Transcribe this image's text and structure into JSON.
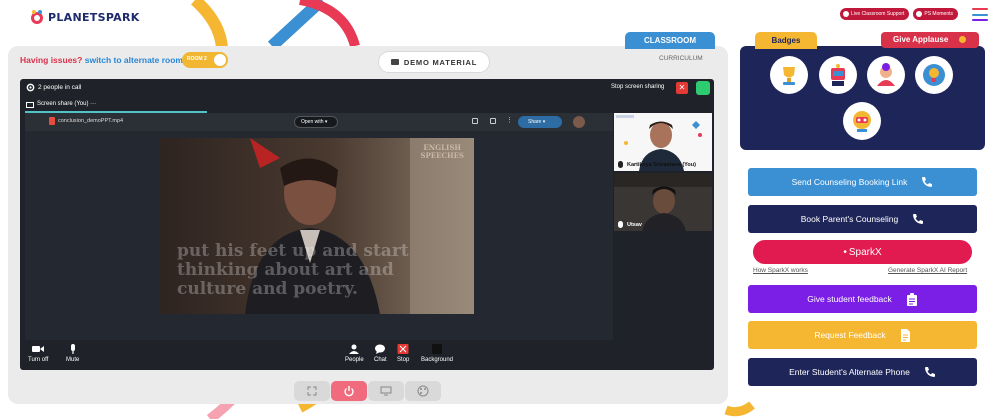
{
  "header": {
    "logo_text": "PLANETSPARK",
    "pills": [
      "Live Classroom Support",
      "PS Moments"
    ]
  },
  "left_panel": {
    "issues_text": "Having issues?",
    "switch_text": "switch to alternate room",
    "room_toggle": "ROOM 2",
    "demo_material": "DEMO MATERIAL",
    "classroom_tab": "CLASSROOM",
    "curriculum": "CURRICULUM"
  },
  "meeting": {
    "people_count": "2 people in call",
    "stop_sharing": "Stop screen sharing",
    "screen_share_tab": "Screen share (You)",
    "file_name": "conclusion_demoPPT.mp4",
    "open_with": "Open with",
    "share": "Share",
    "video_overlay_lines": [
      "put his feet up and start",
      "thinking about art and",
      "culture and poetry."
    ],
    "video_brand": [
      "ENGLISH",
      "SPEECHES"
    ],
    "participants": [
      {
        "name": "Kartikeya Srivastava (You)"
      },
      {
        "name": "Utsav"
      }
    ],
    "controls": {
      "turn_off": "Turn off",
      "mute": "Mute",
      "people": "People",
      "chat": "Chat",
      "stop": "Stop",
      "background": "Background"
    }
  },
  "right_panel": {
    "badges_tab": "Badges",
    "applause_tab": "Give Applause",
    "buttons": {
      "send_counseling": "Send Counseling Booking Link",
      "book_parent": "Book Parent's Counseling",
      "sparkx": "SparkX",
      "how_sparkx": "How SparkX works",
      "generate_sparkx": "Generate SparkX AI Report",
      "student_feedback": "Give student feedback",
      "request_feedback": "Request Feedback",
      "alternate_phone": "Enter Student's Alternate Phone"
    }
  },
  "colors": {
    "brand_navy": "#1e2558",
    "accent_red": "#d8314a",
    "accent_blue": "#3b8fd3",
    "accent_yellow": "#f5b731",
    "purple": "#7b1fe6",
    "sparkx_pink": "#e11a4f"
  },
  "icons": [
    "phone-icon",
    "clipboard-icon",
    "document-icon",
    "power-icon",
    "fullscreen-icon",
    "screen-icon",
    "palette-icon",
    "gear-icon",
    "microphone-icon",
    "camera-icon",
    "people-icon",
    "chat-icon",
    "hamburger-menu-icon"
  ]
}
